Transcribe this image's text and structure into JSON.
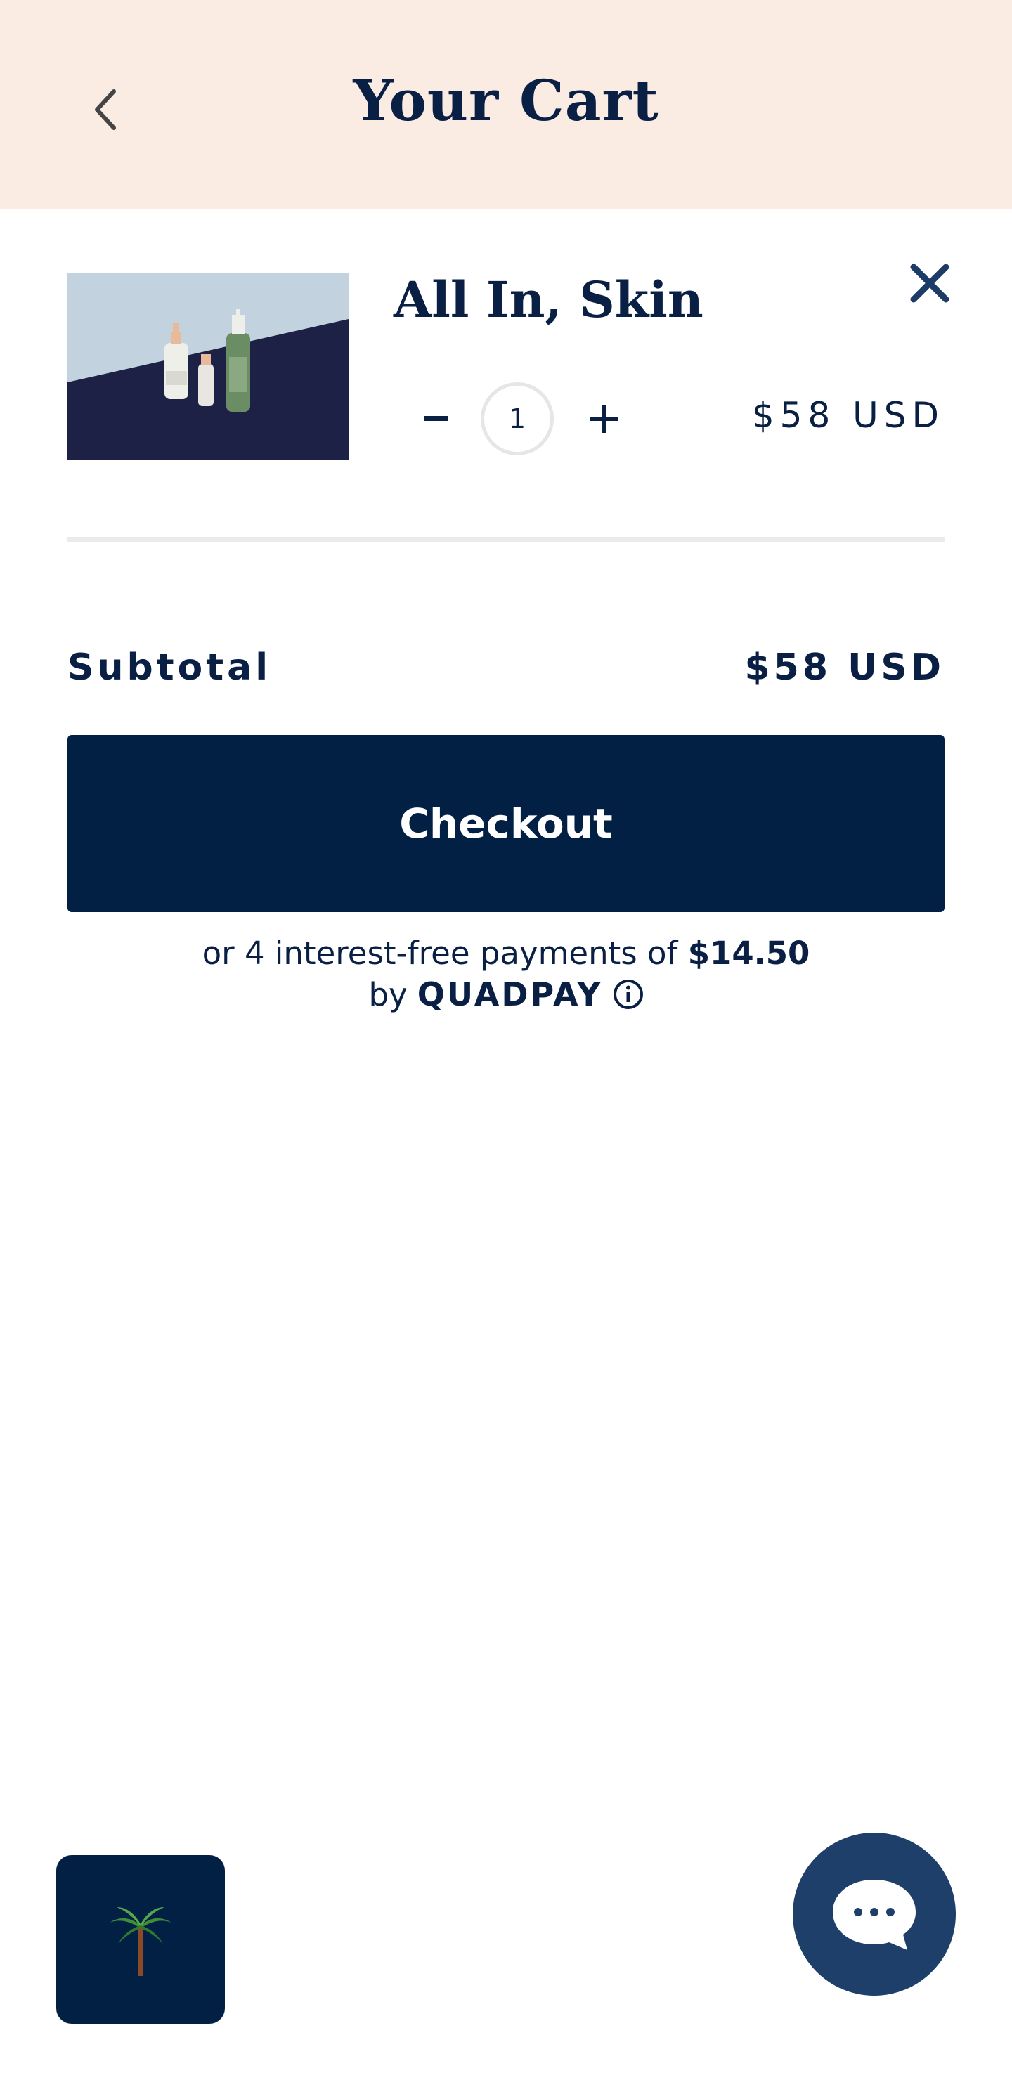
{
  "header": {
    "title": "Your Cart",
    "back_icon": "chevron-left-icon",
    "background": "#faebe3"
  },
  "cart": {
    "items": [
      {
        "name": "All In, Skin",
        "quantity": "1",
        "price": "$58 USD",
        "minus_label": "–",
        "plus_label": "+",
        "remove_icon": "close-icon"
      }
    ]
  },
  "summary": {
    "subtotal_label": "Subtotal",
    "subtotal_value": "$58 USD",
    "checkout_label": "Checkout",
    "installments_prefix": "or 4 interest-free payments of ",
    "installments_amount": "$14.50",
    "by_label": "by",
    "provider": "QUADPAY",
    "info_icon": "info-icon"
  },
  "floating": {
    "palm_icon": "palm-tree-icon",
    "chat_icon": "chat-bubble-icon"
  },
  "colors": {
    "navy": "#021f44",
    "chat_blue": "#1f3f6b",
    "text": "#0a1f44"
  }
}
